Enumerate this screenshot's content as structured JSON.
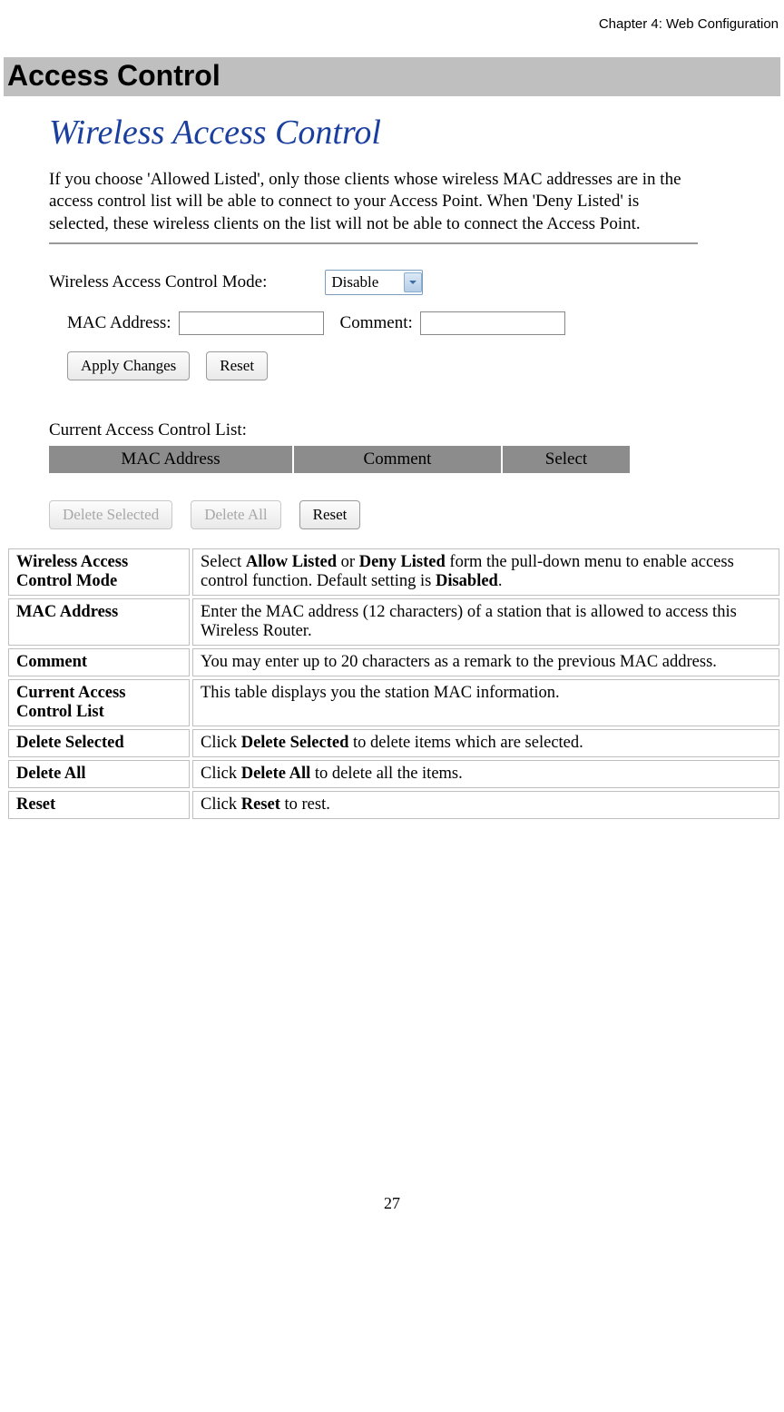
{
  "chapter": "Chapter 4: Web Configuration",
  "section_title": "Access Control",
  "screenshot": {
    "title": "Wireless Access Control",
    "description": "If you choose 'Allowed Listed', only those clients whose wireless MAC addresses are in the access control list will be able to connect to your Access Point. When 'Deny Listed' is selected, these wireless clients on the list will not be able to connect the Access Point.",
    "mode_label": "Wireless Access Control Mode:",
    "mode_value": "Disable",
    "mac_label": "MAC Address:",
    "comment_label": "Comment:",
    "apply_btn": "Apply Changes",
    "reset_btn": "Reset",
    "list_label": "Current Access Control List:",
    "table_headers": {
      "c1": "MAC Address",
      "c2": "Comment",
      "c3": "Select"
    },
    "delete_selected_btn": "Delete Selected",
    "delete_all_btn": "Delete All",
    "reset_btn2": "Reset"
  },
  "rows": [
    {
      "label": "Wireless Access Control Mode",
      "pre": "Select ",
      "b1": "Allow Listed",
      "mid1": " or ",
      "b2": "Deny Listed",
      "mid2": " form the pull-down menu to enable access control function. Default setting is ",
      "b3": "Disabled",
      "post": "."
    },
    {
      "label": "MAC Address",
      "text": "Enter the MAC address (12 characters)  of a station that is allowed to access this Wireless Router."
    },
    {
      "label": "Comment",
      "text": "You may enter up to 20 characters as a remark to the previous MAC address."
    },
    {
      "label": "Current Access Control List",
      "text": " This table displays you the station MAC information."
    },
    {
      "label": "Delete Selected",
      "pre": "Click  ",
      "b1": "Delete Selected",
      "post": " to delete items which are selected."
    },
    {
      "label": "Delete All",
      "pre": "Click  ",
      "b1": "Delete All",
      "post": " to delete all the items."
    },
    {
      "label": "Reset",
      "pre": "Click  ",
      "b1": "Reset",
      "post": " to rest."
    }
  ],
  "page_number": "27"
}
